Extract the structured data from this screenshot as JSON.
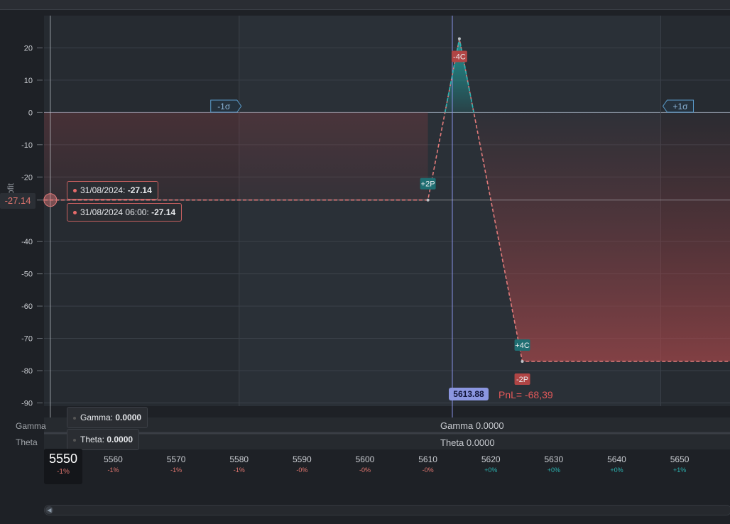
{
  "chart_data": {
    "type": "line",
    "title": "",
    "xlabel": "",
    "ylabel": "Profit",
    "x_ticks": [
      {
        "value": 5550,
        "pct": "-1%"
      },
      {
        "value": 5560,
        "pct": "-1%"
      },
      {
        "value": 5570,
        "pct": "-1%"
      },
      {
        "value": 5580,
        "pct": "-1%"
      },
      {
        "value": 5590,
        "pct": "-0%"
      },
      {
        "value": 5600,
        "pct": "-0%"
      },
      {
        "value": 5610,
        "pct": "-0%"
      },
      {
        "value": 5620,
        "pct": "+0%"
      },
      {
        "value": 5630,
        "pct": "+0%"
      },
      {
        "value": 5640,
        "pct": "+0%"
      },
      {
        "value": 5650,
        "pct": "+1%"
      }
    ],
    "y_ticks": [
      20,
      10,
      0,
      -10,
      -20,
      -40,
      -50,
      -60,
      -70,
      -80,
      -90
    ],
    "xlim": [
      5549,
      5658
    ],
    "ylim": [
      -91,
      30
    ],
    "series": [
      {
        "points": [
          [
            5549,
            -27.14
          ],
          [
            5610,
            -27.14
          ],
          [
            5615,
            22.86
          ],
          [
            5625,
            -77.14
          ],
          [
            5658,
            -77.14
          ]
        ]
      }
    ],
    "sigma_bands": {
      "minus": 5580,
      "plus": 5647,
      "minus_label": "-1σ",
      "plus_label": "+1σ"
    },
    "legs": [
      {
        "label": "+2P",
        "x": 5610,
        "y": -27.14,
        "kind": "long"
      },
      {
        "label": "-4C",
        "x": 5615,
        "y": 22.86,
        "kind": "short"
      },
      {
        "label": "+4C",
        "x": 5625,
        "y": -77.14,
        "kind": "long"
      },
      {
        "label": "-2P",
        "x": 5625,
        "y": -77.14,
        "kind": "short"
      }
    ],
    "current_price": 5613.88,
    "current_price_label": "5613.88",
    "pnl_label": "PnL= -68,39",
    "crosshair": {
      "x": 5550,
      "y": -27.14,
      "y_label": "-27.14",
      "x_label": "5550",
      "x_pct": "-1%"
    }
  },
  "tooltips": {
    "expiry_date": "31/08/2024:",
    "expiry_value": "-27.14",
    "time_date": "31/08/2024 06:00:",
    "time_value": "-27.14"
  },
  "greeks": {
    "gamma_label": "Gamma",
    "theta_label": "Theta",
    "gamma_tip_name": "Gamma:",
    "gamma_tip_value": "0.0000",
    "theta_tip_name": "Theta:",
    "theta_tip_value": "0.0000",
    "gamma_center": "Gamma 0.0000",
    "theta_center": "Theta 0.0000"
  },
  "colors": {
    "loss": "#e07a7a",
    "profit": "#2bb3b1",
    "short_leg": "#b04545",
    "long_leg": "#1f6e72",
    "price_line": "#8a93e8"
  }
}
